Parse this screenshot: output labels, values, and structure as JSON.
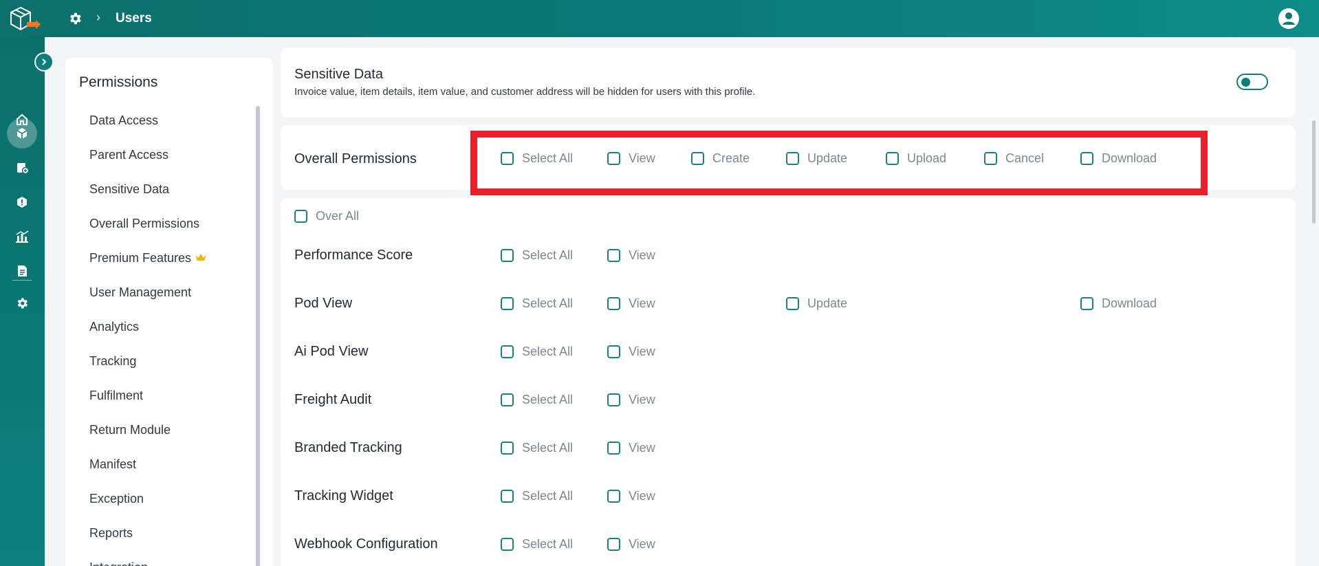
{
  "header": {
    "title": "Users"
  },
  "rail": {
    "items": [
      {
        "icon": "home-icon"
      },
      {
        "icon": "package-icon",
        "active": true
      },
      {
        "icon": "add-document-icon"
      },
      {
        "icon": "shield-icon"
      },
      {
        "icon": "analytics-icon"
      },
      {
        "icon": "invoice-icon"
      },
      {
        "icon": "settings-icon"
      }
    ]
  },
  "permissions_menu": {
    "title": "Permissions",
    "items": [
      {
        "label": "Data Access"
      },
      {
        "label": "Parent Access"
      },
      {
        "label": "Sensitive Data"
      },
      {
        "label": "Overall Permissions"
      },
      {
        "label": "Premium Features",
        "badge": "crown-icon"
      },
      {
        "label": "User Management"
      },
      {
        "label": "Analytics"
      },
      {
        "label": "Tracking"
      },
      {
        "label": "Fulfilment"
      },
      {
        "label": "Return Module"
      },
      {
        "label": "Manifest"
      },
      {
        "label": "Exception"
      },
      {
        "label": "Reports"
      },
      {
        "label": "Integration"
      }
    ]
  },
  "sensitive_data": {
    "title": "Sensitive Data",
    "description": "Invoice value, item details, item value, and customer address will be hidden for users with this profile.",
    "enabled": false
  },
  "overall_permissions": {
    "label": "Overall Permissions",
    "options": [
      "Select All",
      "View",
      "Create",
      "Update",
      "Upload",
      "Cancel",
      "Download"
    ]
  },
  "modules": {
    "over_all_label": "Over All",
    "rows": [
      {
        "label": "Performance Score",
        "options": [
          "Select All",
          "View"
        ]
      },
      {
        "label": "Pod View",
        "options": [
          "Select All",
          "View",
          "Update",
          "Download"
        ]
      },
      {
        "label": "Ai Pod View",
        "options": [
          "Select All",
          "View"
        ]
      },
      {
        "label": "Freight Audit",
        "options": [
          "Select All",
          "View"
        ]
      },
      {
        "label": "Branded Tracking",
        "options": [
          "Select All",
          "View"
        ]
      },
      {
        "label": "Tracking Widget",
        "options": [
          "Select All",
          "View"
        ]
      },
      {
        "label": "Webhook Configuration",
        "options": [
          "Select All",
          "View"
        ]
      }
    ]
  },
  "colors": {
    "brand": "#0b7a77",
    "checkbox_border": "#1a7f86",
    "highlight": "#e8202a",
    "crown": "#f5b400"
  }
}
